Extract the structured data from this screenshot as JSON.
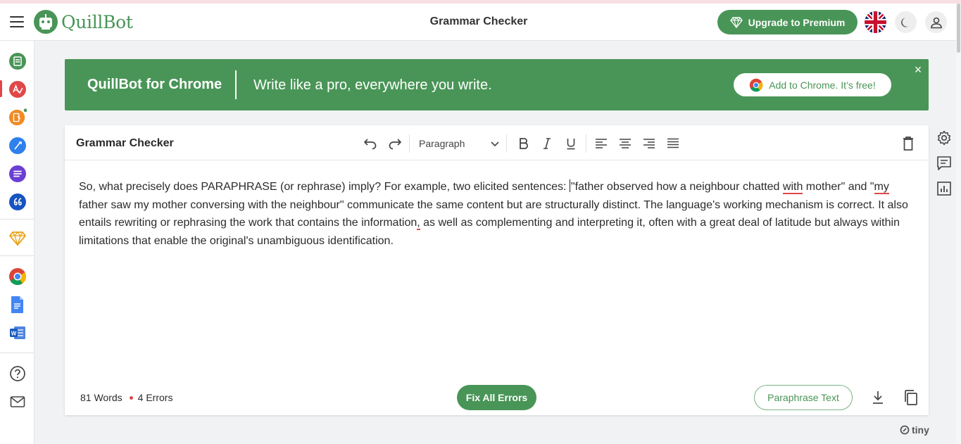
{
  "app": {
    "brand": "QuillBot",
    "page_title": "Grammar Checker",
    "upgrade_label": "Upgrade to Premium"
  },
  "banner": {
    "brand": "QuillBot for Chrome",
    "tagline": "Write like a pro, everywhere you write.",
    "cta_label": "Add to Chrome. It’s free!",
    "close_symbol": "×"
  },
  "editor": {
    "title": "Grammar Checker",
    "paragraph_select": "Paragraph",
    "text": {
      "p1": "So, what precisely does PARAPHRASE (or rephrase) imply? For example, two elicited sentences: ",
      "p2": "\"father observed how a neighbour chatted ",
      "err1": "with",
      "p3": " mother\" and \"",
      "err2": "my",
      "p4": " father saw my mother conversing with the neighbour\" communicate the same content but are structurally distinct. The language's working mechanism is correct. It also entails rewriting or rephrasing the work that contains the information",
      "err3": ",",
      "p5": " as well as complementing and interpreting it, often with a great deal of latitude but always within limitations that enable the original's unambiguous identification."
    },
    "footer": {
      "words": "81 Words",
      "errors": "4 Errors",
      "fix_label": "Fix All Errors",
      "paraphrase_label": "Paraphrase Text"
    }
  },
  "powered_by": "tiny",
  "colors": {
    "brand_green": "#499557",
    "error_red": "#e04848"
  },
  "icons": {
    "sidebar": [
      "paraphraser-icon",
      "grammar-checker-icon",
      "co-writer-icon",
      "writing-assistant-icon",
      "summarizer-icon",
      "citation-icon",
      "premium-icon",
      "chrome-extension-icon",
      "google-docs-icon",
      "word-icon",
      "help-icon",
      "mail-icon"
    ],
    "right_rail": [
      "settings-icon",
      "feedback-icon",
      "stats-icon"
    ]
  }
}
